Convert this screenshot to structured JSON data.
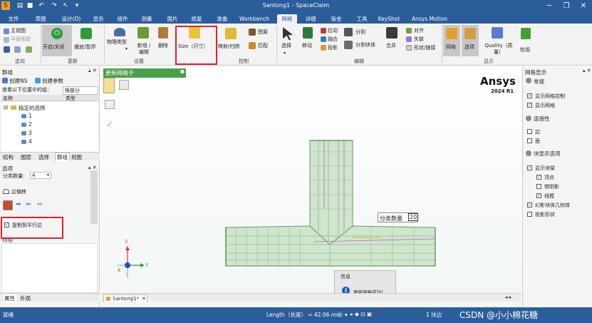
{
  "app": {
    "window_title": "Santong1 - SpaceClaim",
    "brand_color": "#2b5d9b",
    "accent_red": "#e0212b"
  },
  "menu": {
    "tabs": [
      "文件",
      "草图",
      "设计(D)",
      "显示",
      "组件",
      "测量",
      "面片",
      "修复",
      "准备",
      "Workbench",
      "网格",
      "详细",
      "钣金",
      "工具",
      "KeyShot",
      "Ansys Motion"
    ],
    "active": "网格"
  },
  "ribbon": {
    "orient": {
      "main_view": "主视图",
      "plane_view": "平面视图",
      "label": "定向"
    },
    "update": {
      "toggle": "开启/关闭",
      "play_pause": "播放/暂停",
      "label": "更新"
    },
    "settings": {
      "physics_type": "物理类型",
      "add_edit": "新增 / 编辑",
      "delete": "删除",
      "size": "Size（尺寸）",
      "label": "设置"
    },
    "control": {
      "sweep": "映射/扫掠",
      "pattern": "图案",
      "match": "匹配",
      "label": "控制"
    },
    "edit": {
      "select": "选择",
      "move": "移动",
      "pull": "拉动",
      "fuse": "融合",
      "project": "投影",
      "split": "分割",
      "split_block": "分割块体",
      "merge": "合并",
      "align": "对齐",
      "clear": "失联",
      "shape_link": "形状/链接",
      "label": "编辑"
    },
    "display": {
      "mesh": "网格",
      "select": "选项",
      "quality": "Quality（质量）",
      "check": "检视",
      "label": "显示"
    }
  },
  "left_panel": {
    "title": "群组",
    "create_ns": "创建NS",
    "create_param": "创建参数",
    "query_label": "查看以下位置中的组：",
    "query_value": "根部分",
    "col_name": "名称",
    "col_type": "类型",
    "tree_root": "指定的选择",
    "tree_items": [
      "1",
      "2",
      "3",
      "4"
    ],
    "tabs": [
      "结构",
      "图层",
      "选择",
      "群组",
      "视图"
    ],
    "active_tab": "群组"
  },
  "options_panel": {
    "title": "选项",
    "count_label": "分类数量:",
    "count_value": "4",
    "offset_label": "边偏移",
    "copy_parallel": "复制到平行边",
    "copy_parallel_checked": true,
    "section_title": "网格"
  },
  "bottom_tabs": [
    "属性",
    "外观"
  ],
  "viewport": {
    "toolbar_title": "更新网格于",
    "ansys_logo": "Ansys",
    "ansys_version": "2024 R1",
    "inline_label": "分类数量",
    "inline_value": "20",
    "axis_x": "X",
    "axis_y": "Y",
    "axis_z": "Z",
    "doc_tab": "Santong1*"
  },
  "message": {
    "title": "信息",
    "text": "更新网格成功！"
  },
  "right_panel": {
    "title": "网格显示",
    "sections": [
      {
        "title": "常规",
        "items": [
          {
            "label": "显示网格控制",
            "checked": true
          },
          {
            "label": "显示网格",
            "checked": true
          }
        ]
      },
      {
        "title": "连接性",
        "items": [
          {
            "label": "边",
            "checked": false
          },
          {
            "label": "面",
            "checked": false
          }
        ]
      },
      {
        "title": "块显示选项",
        "items": [
          {
            "label": "显示块架",
            "checked": true
          },
          {
            "label": "顶点",
            "checked": true
          },
          {
            "label": "带阴影",
            "checked": false
          },
          {
            "label": "线框",
            "checked": true
          },
          {
            "label": "幻影块体几何体",
            "checked": true
          },
          {
            "label": "投影形状",
            "checked": false
          }
        ]
      }
    ]
  },
  "status": {
    "ready": "就绪",
    "length": "Length（长度） = 42.06 mm",
    "blocks": "1 块边",
    "watermark": "CSDN @小小棉花糖"
  }
}
